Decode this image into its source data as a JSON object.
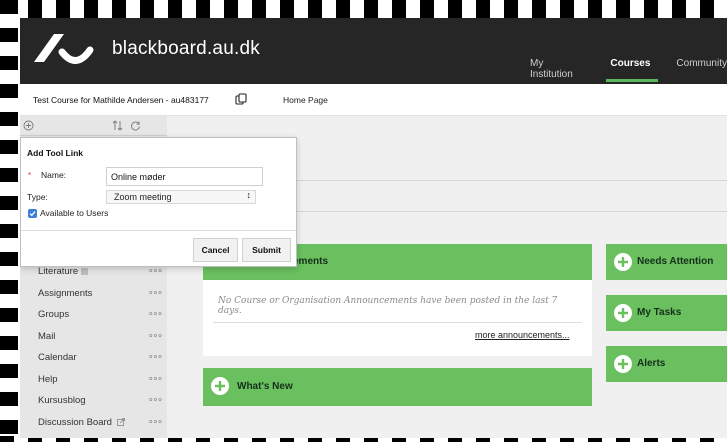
{
  "header": {
    "brand": "blackboard.au.dk",
    "nav": [
      "My Institution",
      "Courses",
      "Community"
    ],
    "active_nav": "Courses"
  },
  "breadcrumb": {
    "course_title": "Test Course for Mathilde Andersen - au483177",
    "home": "Home Page"
  },
  "menu": {
    "items": [
      {
        "label": "Literature",
        "more": "∘∘∘"
      },
      {
        "label": "Assignments",
        "more": "∘∘∘"
      },
      {
        "label": "Groups",
        "more": "∘∘∘"
      },
      {
        "label": "Mail",
        "more": "∘∘∘"
      },
      {
        "label": "Calendar",
        "more": "∘∘∘"
      },
      {
        "label": "Help",
        "more": "∘∘∘"
      },
      {
        "label": "Kursusblog",
        "more": "∘∘∘"
      },
      {
        "label": "Discussion Board",
        "more": "∘∘∘"
      }
    ]
  },
  "dialog": {
    "title": "Add Tool Link",
    "required_mark": "*",
    "name_label": "Name:",
    "name_value": "Online møder",
    "type_label": "Type:",
    "type_value": "Zoom meeting",
    "available_label": "Available to Users",
    "available_checked": true,
    "cancel_label": "Cancel",
    "submit_label": "Submit"
  },
  "modules": {
    "announcements": {
      "title_visible": "ements",
      "empty_text": "No Course or Organisation Announcements have been posted in the last 7 days.",
      "more_link": "more announcements..."
    },
    "whats_new": {
      "title": "What's New"
    },
    "needs_attention": {
      "title": "Needs Attention"
    },
    "my_tasks": {
      "title": "My Tasks"
    },
    "alerts": {
      "title": "Alerts"
    }
  },
  "colors": {
    "header_bg": "#262626",
    "accent_green": "#6abf5f",
    "menu_bg": "#e6e6e6",
    "checkbox_blue": "#3a7fd5"
  }
}
